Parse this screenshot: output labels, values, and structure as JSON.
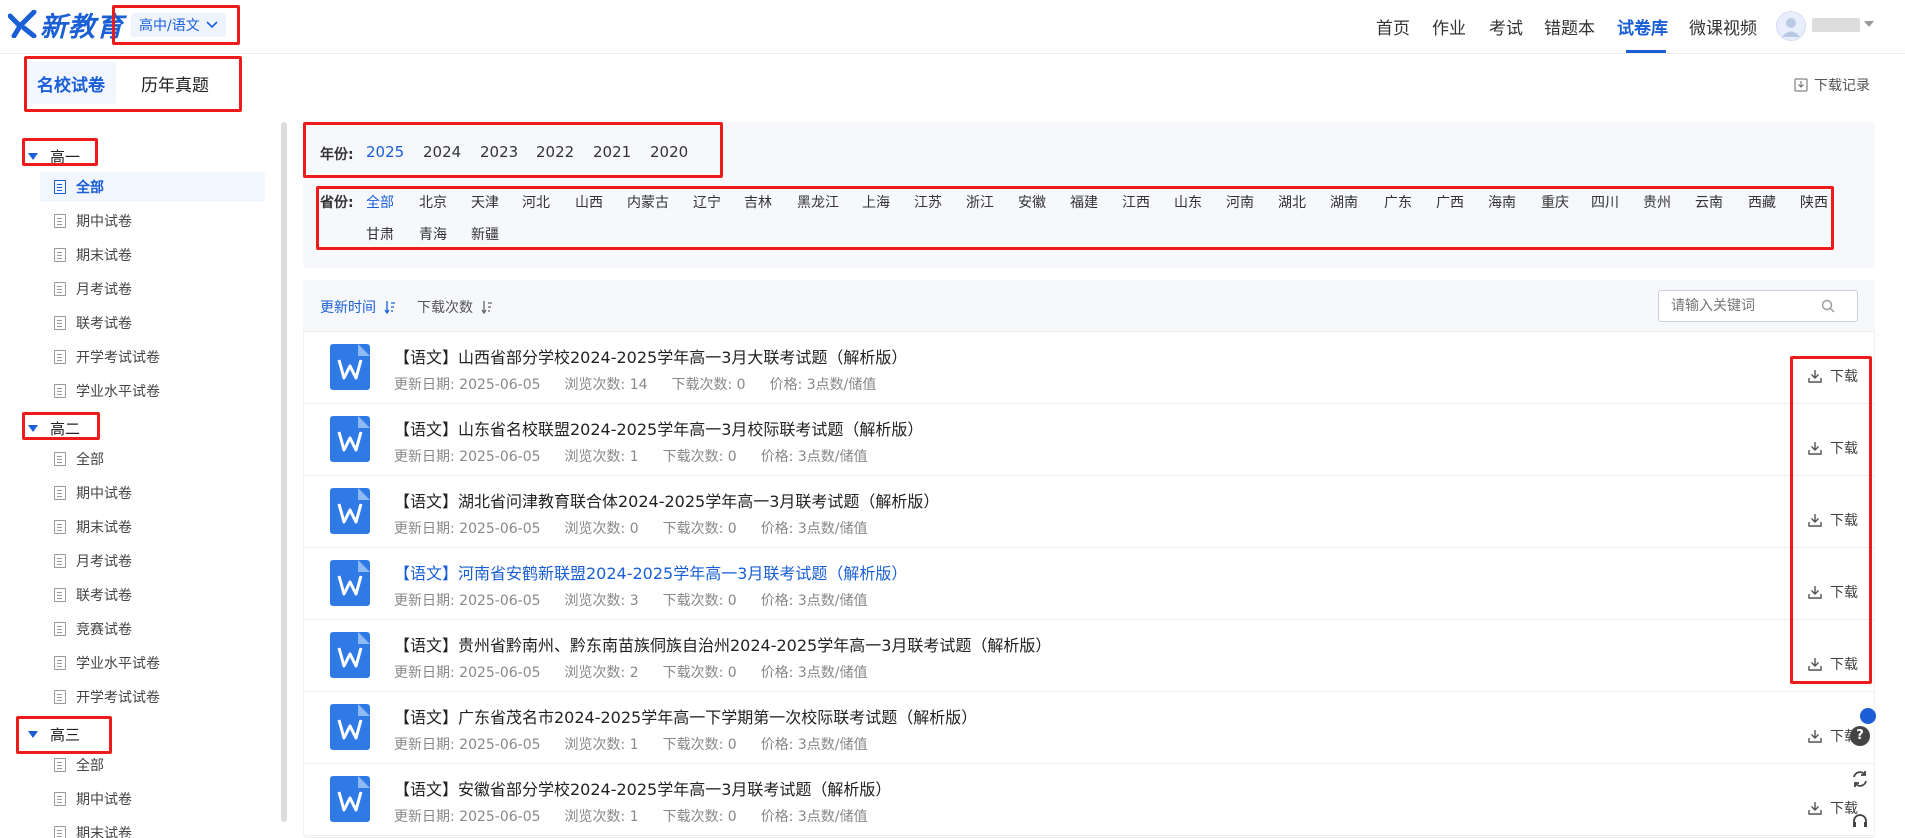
{
  "header": {
    "logo_text": "新教育",
    "grade_select": "高中/语文",
    "nav": [
      "首页",
      "作业",
      "考试",
      "错题本",
      "试卷库",
      "微课视频"
    ],
    "nav_active": "试卷库"
  },
  "tabs": {
    "tab1": "名校试卷",
    "tab2": "历年真题"
  },
  "download_record": "下载记录",
  "sidebar": {
    "g1": {
      "label": "高一",
      "items": [
        "全部",
        "期中试卷",
        "期末试卷",
        "月考试卷",
        "联考试卷",
        "开学考试试卷",
        "学业水平试卷"
      ]
    },
    "g2": {
      "label": "高二",
      "items": [
        "全部",
        "期中试卷",
        "期末试卷",
        "月考试卷",
        "联考试卷",
        "竞赛试卷",
        "学业水平试卷",
        "开学考试试卷"
      ]
    },
    "g3": {
      "label": "高三",
      "items": [
        "全部",
        "期中试卷",
        "期末试卷"
      ]
    }
  },
  "filter": {
    "year_label": "年份:",
    "years": [
      "2025",
      "2024",
      "2023",
      "2022",
      "2021",
      "2020"
    ],
    "province_label": "省份:",
    "provinces": [
      "全部",
      "北京",
      "天津",
      "河北",
      "山西",
      "内蒙古",
      "辽宁",
      "吉林",
      "黑龙江",
      "上海",
      "江苏",
      "浙江",
      "安徽",
      "福建",
      "江西",
      "山东",
      "河南",
      "湖北",
      "湖南",
      "广东",
      "广西",
      "海南",
      "重庆",
      "四川",
      "贵州",
      "云南",
      "西藏",
      "陕西",
      "甘肃",
      "青海",
      "新疆"
    ]
  },
  "sort": {
    "by_time": "更新时间",
    "by_downloads": "下载次数"
  },
  "search": {
    "placeholder": "请输入关键词"
  },
  "download_label": "下载",
  "rows": [
    {
      "title": "【语文】山西省部分学校2024-2025学年高一3月大联考试题（解析版）",
      "date": "更新日期: 2025-06-05",
      "views": "浏览次数: 14",
      "downloads": "下载次数: 0",
      "price": "价格: 3点数/储值"
    },
    {
      "title": "【语文】山东省名校联盟2024-2025学年高一3月校际联考试题（解析版）",
      "date": "更新日期: 2025-06-05",
      "views": "浏览次数: 1",
      "downloads": "下载次数: 0",
      "price": "价格: 3点数/储值"
    },
    {
      "title": "【语文】湖北省问津教育联合体2024-2025学年高一3月联考试题（解析版）",
      "date": "更新日期: 2025-06-05",
      "views": "浏览次数: 0",
      "downloads": "下载次数: 0",
      "price": "价格: 3点数/储值"
    },
    {
      "title": "【语文】河南省安鹤新联盟2024-2025学年高一3月联考试题（解析版）",
      "date": "更新日期: 2025-06-05",
      "views": "浏览次数: 3",
      "downloads": "下载次数: 0",
      "price": "价格: 3点数/储值"
    },
    {
      "title": "【语文】贵州省黔南州、黔东南苗族侗族自治州2024-2025学年高一3月联考试题（解析版）",
      "date": "更新日期: 2025-06-05",
      "views": "浏览次数: 2",
      "downloads": "下载次数: 0",
      "price": "价格: 3点数/储值"
    },
    {
      "title": "【语文】广东省茂名市2024-2025学年高一下学期第一次校际联考试题（解析版）",
      "date": "更新日期: 2025-06-05",
      "views": "浏览次数: 1",
      "downloads": "下载次数: 0",
      "price": "价格: 3点数/储值"
    },
    {
      "title": "【语文】安徽省部分学校2024-2025学年高一3月联考试题（解析版）",
      "date": "更新日期: 2025-06-05",
      "views": "浏览次数: 1",
      "downloads": "下载次数: 0",
      "price": "价格: 3点数/储值"
    }
  ],
  "colors": {
    "accent": "#1a5fd6",
    "highlight_box": "#ee1b1b"
  }
}
